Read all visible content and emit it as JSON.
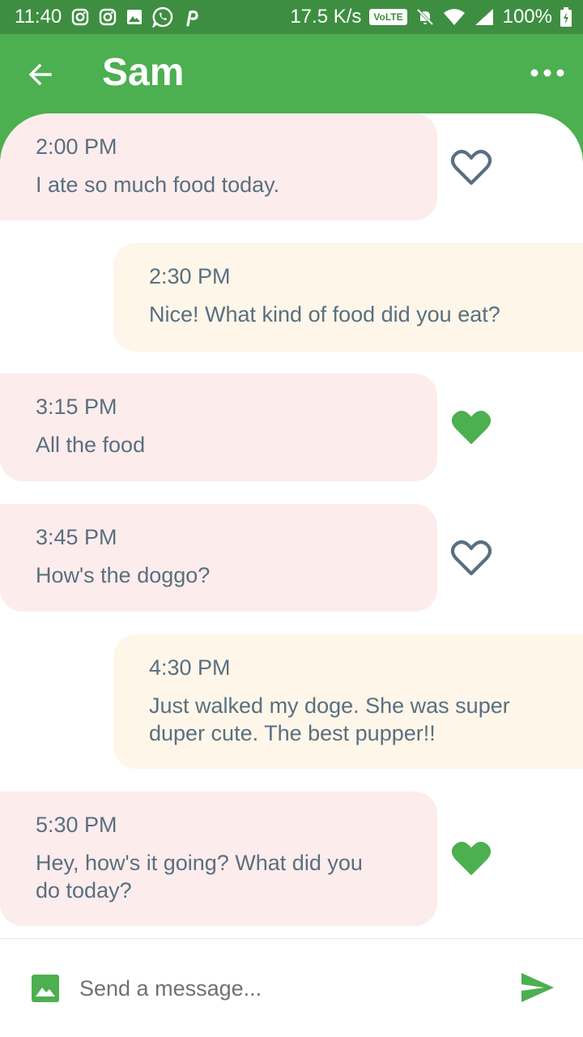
{
  "status_bar": {
    "time": "11:40",
    "net_speed": "17.5 K/s",
    "volte": "VoLTE",
    "battery": "100%"
  },
  "app_bar": {
    "title": "Sam",
    "back_icon": "arrow-back-icon",
    "menu_icon": "more-horizontal-icon"
  },
  "messages": [
    {
      "time": "2:00 PM",
      "text": "I ate so much food today.",
      "side": "incoming",
      "liked": false
    },
    {
      "time": "2:30 PM",
      "text": "Nice! What kind of food did you eat?",
      "side": "outgoing"
    },
    {
      "time": "3:15 PM",
      "text": "All the food",
      "side": "incoming",
      "liked": true
    },
    {
      "time": "3:45 PM",
      "text": "How's the doggo?",
      "side": "incoming",
      "liked": false
    },
    {
      "time": "4:30 PM",
      "text": "Just walked my doge. She was super duper cute. The best pupper!!",
      "side": "outgoing"
    },
    {
      "time": "5:30 PM",
      "text": "Hey, how's it going? What did you do today?",
      "side": "incoming",
      "liked": true
    }
  ],
  "composer": {
    "placeholder": "Send a message...",
    "image_icon": "image-icon",
    "send_icon": "send-icon"
  },
  "colors": {
    "primary": "#4caf50",
    "status_bar": "#3e8e41",
    "incoming_bubble": "#fdecec",
    "outgoing_bubble": "#fdf6e9",
    "text": "#5a6f80",
    "heart_outline": "#5a6f80",
    "heart_filled": "#4caf50"
  }
}
